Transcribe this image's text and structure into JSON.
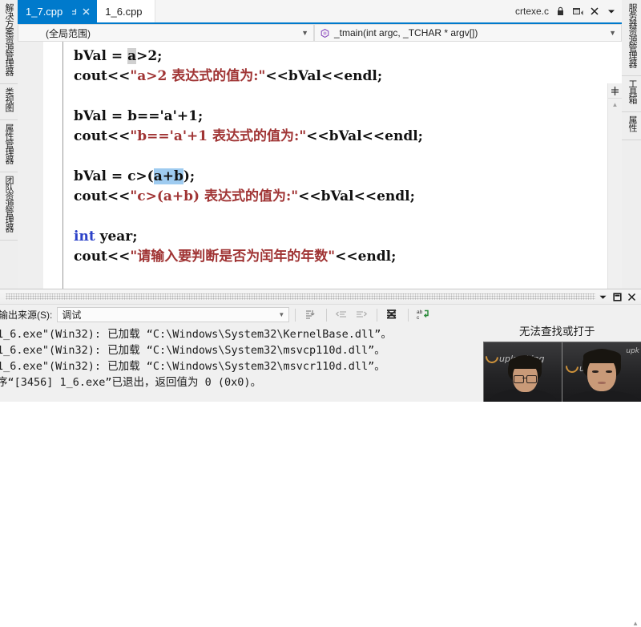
{
  "left_dock": {
    "items": [
      {
        "label": "解决方案资源管理器",
        "name": "solution-explorer"
      },
      {
        "label": "类视图",
        "name": "class-view"
      },
      {
        "label": "属性管理器",
        "name": "property-manager"
      },
      {
        "label": "团队资源管理器",
        "name": "team-explorer"
      }
    ]
  },
  "right_dock": {
    "items": [
      {
        "label": "服务器资源管理器",
        "name": "server-explorer"
      },
      {
        "label": "工具箱",
        "name": "toolbox"
      },
      {
        "label": "属性",
        "name": "properties"
      }
    ]
  },
  "tabs": {
    "active": {
      "label": "1_7.cpp"
    },
    "inactive": {
      "label": "1_6.cpp"
    },
    "right_doc": {
      "label": "crtexe.c"
    }
  },
  "navbar": {
    "scope": "(全局范围)",
    "function": "_tmain(int argc, _TCHAR * argv[])"
  },
  "code": {
    "lines": [
      [
        {
          "t": "bVal = ",
          "c": "plain"
        },
        {
          "t": "a",
          "c": "plain",
          "sel": "gray"
        },
        {
          "t": ">2;",
          "c": "plain"
        }
      ],
      [
        {
          "t": "cout<<",
          "c": "plain"
        },
        {
          "t": "\"a>2 表达式的值为:\"",
          "c": "str"
        },
        {
          "t": "<<bVal<<endl;",
          "c": "plain"
        }
      ],
      [],
      [
        {
          "t": "bVal = b=='a'+1;",
          "c": "plain"
        }
      ],
      [
        {
          "t": "cout<<",
          "c": "plain"
        },
        {
          "t": "\"b=='a'+1 表达式的值为:\"",
          "c": "str"
        },
        {
          "t": "<<bVal<<endl;",
          "c": "plain"
        }
      ],
      [],
      [
        {
          "t": "bVal = c>(",
          "c": "plain"
        },
        {
          "t": "a+b",
          "c": "plain",
          "sel": "blue"
        },
        {
          "t": ");",
          "c": "plain"
        }
      ],
      [
        {
          "t": "cout<<",
          "c": "plain"
        },
        {
          "t": "\"c>(a+b) 表达式的值为:\"",
          "c": "str"
        },
        {
          "t": "<<bVal<<endl;",
          "c": "plain"
        }
      ],
      [],
      [
        {
          "t": "int",
          "c": "kw"
        },
        {
          "t": " year;",
          "c": "plain"
        }
      ],
      [
        {
          "t": "cout<<",
          "c": "plain"
        },
        {
          "t": "\"请输入要判断是否为闰年的年数\"",
          "c": "str"
        },
        {
          "t": "<<endl;",
          "c": "plain"
        }
      ]
    ]
  },
  "output": {
    "source_label": "输出来源(S):",
    "source_value": "调试",
    "lines": [
      "1_6.exe\"(Win32): 已加载 “C:\\Windows\\System32\\KernelBase.dll”。",
      "1_6.exe\"(Win32): 已加载 “C:\\Windows\\System32\\msvcp110d.dll”。",
      "1_6.exe\"(Win32): 已加载 “C:\\Windows\\System32\\msvcr110d.dll”。",
      "序“[3456] 1_6.exe”已退出，返回值为 0 (0x0)。"
    ],
    "overflow_text": "无法查找或打于"
  },
  "webcam": {
    "logo_text": "upk",
    "logo_text_full": "upkacking"
  },
  "colors": {
    "accent": "#007acc",
    "string": "#a03434",
    "keyword": "#2b41c8",
    "selection_blue": "#9ecbf0",
    "selection_gray": "#d0d0d0"
  }
}
